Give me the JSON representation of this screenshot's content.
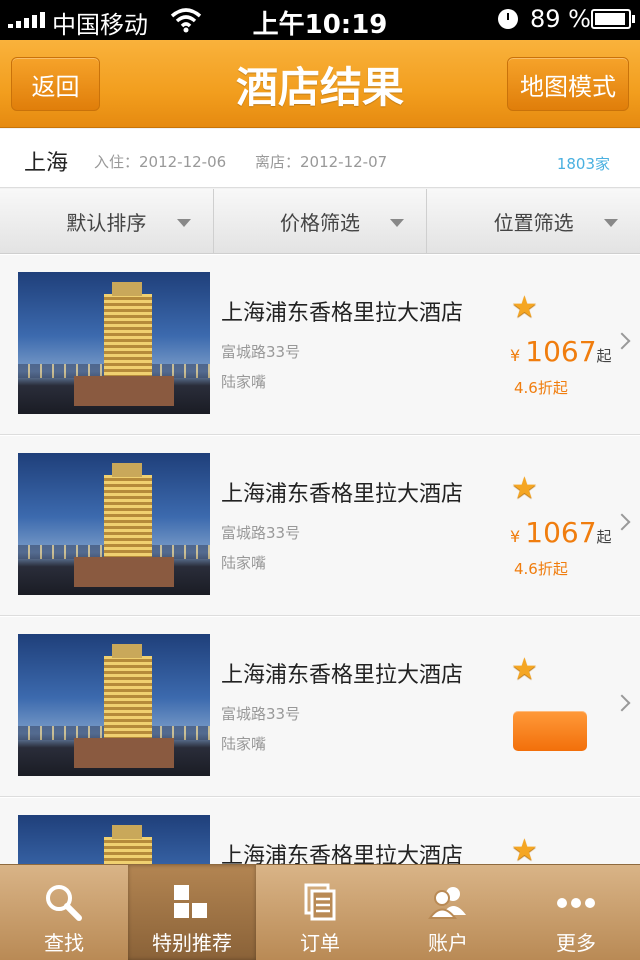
{
  "status_bar": {
    "carrier": "中国移动",
    "time": "上午10:19",
    "battery": "89 %"
  },
  "nav": {
    "back_label": "返回",
    "title": "酒店结果",
    "map_label": "地图模式"
  },
  "info": {
    "city": "上海",
    "checkin": "入住：2012-12-06",
    "checkout": "离店：2012-12-07",
    "count": "1803家"
  },
  "filters": [
    {
      "label": "默认排序"
    },
    {
      "label": "价格筛选"
    },
    {
      "label": "位置筛选"
    }
  ],
  "hotels": [
    {
      "name": "上海浦东香格里拉大酒店",
      "address": "富城路33号",
      "area": "陆家嘴",
      "currency": "¥",
      "price": "1067",
      "price_suffix": "起",
      "discount": "4.6折起"
    },
    {
      "name": "上海浦东香格里拉大酒店",
      "address": "富城路33号",
      "area": "陆家嘴",
      "currency": "¥",
      "price": "1067",
      "price_suffix": "起",
      "discount": "4.6折起"
    },
    {
      "name": "上海浦东香格里拉大酒店",
      "address": "富城路33号",
      "area": "陆家嘴"
    },
    {
      "name": "上海浦东香格里拉大酒店"
    }
  ],
  "tabs": [
    {
      "label": "查找",
      "icon": "search-icon"
    },
    {
      "label": "特别推荐",
      "icon": "grid-icon"
    },
    {
      "label": "订单",
      "icon": "document-icon"
    },
    {
      "label": "账户",
      "icon": "user-icon"
    },
    {
      "label": "更多",
      "icon": "more-icon"
    }
  ],
  "colors": {
    "nav_orange": "#f29e1e",
    "price_orange": "#f07d0e",
    "count_blue": "#4ab0e0",
    "tab_brown": "#b98a55"
  }
}
